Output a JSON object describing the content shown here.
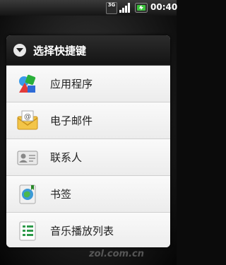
{
  "status_bar": {
    "network": "3G",
    "time": "00:40",
    "icons": [
      "3g-icon",
      "signal-icon",
      "battery-icon"
    ]
  },
  "dialog": {
    "title": "选择快捷键",
    "header_icon": "chevron-down-circle-icon",
    "items": [
      {
        "label": "应用程序",
        "icon": "applications-icon"
      },
      {
        "label": "电子邮件",
        "icon": "email-icon"
      },
      {
        "label": "联系人",
        "icon": "contacts-icon"
      },
      {
        "label": "书签",
        "icon": "bookmark-icon"
      },
      {
        "label": "音乐播放列表",
        "icon": "music-playlist-icon"
      }
    ]
  },
  "watermark": {
    "text": "zol.com.cn"
  },
  "colors": {
    "status_bar": "#1e1e1e",
    "dialog_header": "#1f1f1f",
    "dialog_body": "#f4f4f4",
    "battery_green": "#3cc23c"
  }
}
